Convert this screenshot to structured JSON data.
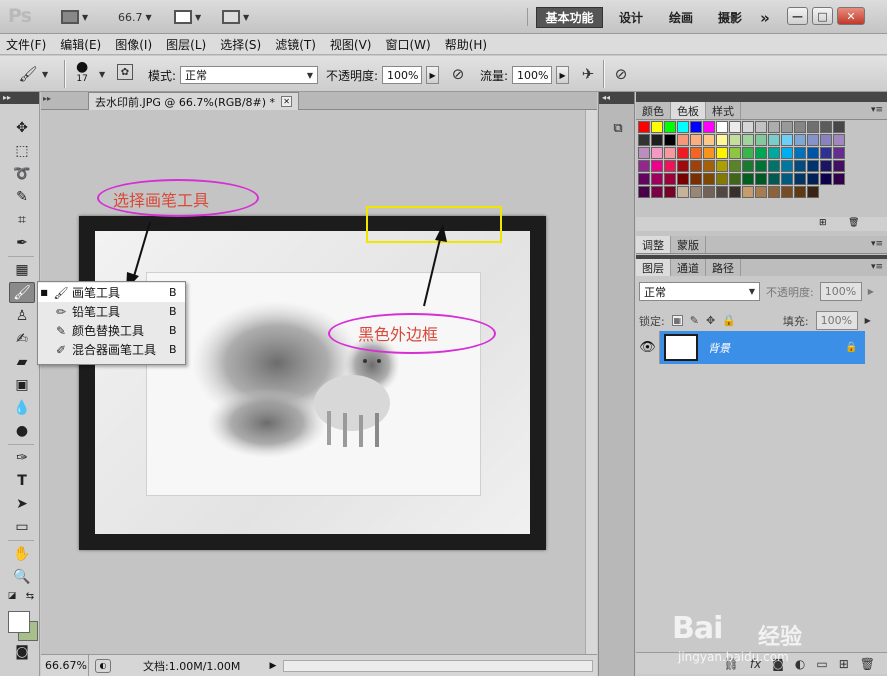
{
  "app": {
    "logo": "Ps",
    "zoom": "66.7",
    "workspaces": [
      "基本功能",
      "设计",
      "绘画",
      "摄影"
    ],
    "more": "»",
    "window_buttons": [
      "—",
      "□",
      "✕"
    ]
  },
  "menu": [
    "文件(F)",
    "编辑(E)",
    "图像(I)",
    "图层(L)",
    "选择(S)",
    "滤镜(T)",
    "视图(V)",
    "窗口(W)",
    "帮助(H)"
  ],
  "options": {
    "brush_size": "17",
    "mode_label": "模式:",
    "mode_value": "正常",
    "opacity_label": "不透明度:",
    "opacity_value": "100%",
    "flow_label": "流量:",
    "flow_value": "100%"
  },
  "document": {
    "tab_title": "去水印前.JPG @ 66.7%(RGB/8#) *",
    "status_zoom": "66.67%",
    "status_doc": "文档:1.00M/1.00M"
  },
  "flyout": [
    {
      "label": "画笔工具",
      "key": "B",
      "icon": "brush-icon",
      "glyph": "🖌",
      "selected": true
    },
    {
      "label": "铅笔工具",
      "key": "B",
      "icon": "pencil-icon",
      "glyph": "✏",
      "selected": false
    },
    {
      "label": "颜色替换工具",
      "key": "B",
      "icon": "color-replace-icon",
      "glyph": "✎",
      "selected": false
    },
    {
      "label": "混合器画笔工具",
      "key": "B",
      "icon": "mixer-brush-icon",
      "glyph": "✐",
      "selected": false
    }
  ],
  "swatches_panel": {
    "tabs": [
      "颜色",
      "色板",
      "样式"
    ],
    "active": "色板",
    "colors": [
      "#ff0000",
      "#ffff00",
      "#00ff00",
      "#00ffff",
      "#0000ff",
      "#ff00ff",
      "#ffffff",
      "#ebebeb",
      "#d6d6d6",
      "#c2c2c2",
      "#adadad",
      "#999999",
      "#858585",
      "#707070",
      "#5c5c5c",
      "#474747",
      "#333333",
      "#1f1f1f",
      "#000000",
      "#f7977a",
      "#f9ad81",
      "#fdc68a",
      "#fff79a",
      "#c4df9b",
      "#a2d39c",
      "#82ca9d",
      "#7bcdc8",
      "#6ecff6",
      "#7ea7d8",
      "#8493ca",
      "#8882be",
      "#a187be",
      "#bc8dbf",
      "#f49ac2",
      "#f6989d",
      "#ed1c24",
      "#f26522",
      "#f7941d",
      "#fff200",
      "#8dc73f",
      "#39b54a",
      "#00a651",
      "#00a99d",
      "#00aeef",
      "#0072bc",
      "#0054a6",
      "#2e3192",
      "#662d91",
      "#92278f",
      "#ec008c",
      "#ed145b",
      "#9e0b0f",
      "#a0410d",
      "#a36209",
      "#aba000",
      "#598527",
      "#197b30",
      "#007236",
      "#00746b",
      "#0076a3",
      "#004b80",
      "#003471",
      "#1b1464",
      "#440e62",
      "#630460",
      "#9e005d",
      "#9e0039",
      "#790000",
      "#7b2e00",
      "#7d4900",
      "#827b00",
      "#406618",
      "#005e20",
      "#005826",
      "#005952",
      "#005b7f",
      "#003663",
      "#002157",
      "#0d004c",
      "#32004b",
      "#4b0049",
      "#7b0046",
      "#7a0026",
      "#c7b299",
      "#998675",
      "#736357",
      "#534741",
      "#37302d",
      "#c69c6d",
      "#a67c52",
      "#8c6239",
      "#754c24",
      "#603913",
      "#3c2415"
    ]
  },
  "adjust_panel": {
    "tabs": [
      "调整",
      "蒙版"
    ]
  },
  "layers_panel": {
    "tabs": [
      "图层",
      "通道",
      "路径"
    ],
    "blend": "正常",
    "opacity_label": "不透明度:",
    "opacity_value": "100%",
    "lock_label": "锁定:",
    "fill_label": "填充:",
    "fill_value": "100%",
    "layer_name": "背景"
  },
  "annotations": {
    "select_brush": "选择画笔工具",
    "black_border": "黑色外边框"
  },
  "watermark": {
    "brand": "Bai",
    "brand2": "经验",
    "url": "jingyan.baidu.com"
  }
}
